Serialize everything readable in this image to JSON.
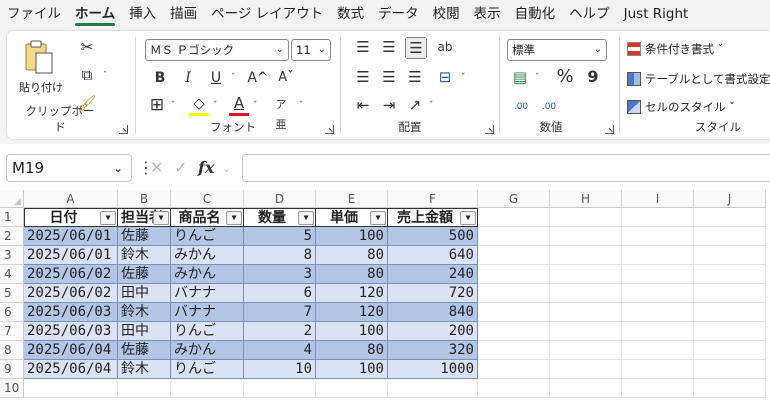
{
  "menu": {
    "tabs": [
      "ファイル",
      "ホーム",
      "挿入",
      "描画",
      "ページ レイアウト",
      "数式",
      "データ",
      "校閲",
      "表示",
      "自動化",
      "ヘルプ",
      "Just Right"
    ],
    "active": "ホーム"
  },
  "ribbon": {
    "clipboard": {
      "paste_label": "貼り付け",
      "group_label": "クリップボード"
    },
    "font": {
      "font_name": "ＭＳ Ｐゴシック",
      "font_size": "11",
      "bold": "B",
      "italic": "I",
      "underline": "U",
      "grow": "A^",
      "shrink": "Aˇ",
      "color_a": "A",
      "group_label": "フォント"
    },
    "alignment": {
      "group_label": "配置"
    },
    "number": {
      "format": "標準",
      "percent": "%",
      "comma": "9",
      "inc_decimal": ".00",
      "dec_decimal": ".00",
      "group_label": "数値"
    },
    "styles": {
      "conditional": "条件付き書式 ˇ",
      "table": "テーブルとして書式設定",
      "cell_styles": "セルのスタイル ˇ",
      "group_label": "スタイル"
    }
  },
  "formula_bar": {
    "name_box": "M19",
    "fx": "fx",
    "value": ""
  },
  "columns": [
    "A",
    "B",
    "C",
    "D",
    "E",
    "F",
    "G",
    "H",
    "I",
    "J"
  ],
  "rows": [
    "1",
    "2",
    "3",
    "4",
    "5",
    "6",
    "7",
    "8",
    "9",
    "10"
  ],
  "table": {
    "headers": [
      "日付",
      "担当者",
      "商品名",
      "数量",
      "単価",
      "売上金額"
    ],
    "rows": [
      [
        "2025/06/01",
        "佐藤",
        "りんご",
        "5",
        "100",
        "500"
      ],
      [
        "2025/06/01",
        "鈴木",
        "みかん",
        "8",
        "80",
        "640"
      ],
      [
        "2025/06/02",
        "佐藤",
        "みかん",
        "3",
        "80",
        "240"
      ],
      [
        "2025/06/02",
        "田中",
        "バナナ",
        "6",
        "120",
        "720"
      ],
      [
        "2025/06/03",
        "鈴木",
        "バナナ",
        "7",
        "120",
        "840"
      ],
      [
        "2025/06/03",
        "田中",
        "りんご",
        "2",
        "100",
        "200"
      ],
      [
        "2025/06/04",
        "佐藤",
        "みかん",
        "4",
        "80",
        "320"
      ],
      [
        "2025/06/04",
        "鈴木",
        "りんご",
        "10",
        "100",
        "1000"
      ]
    ]
  },
  "colors": {
    "band_dark": "#b4c6e7",
    "band_light": "#dae3f3",
    "accent": "#1f7a45"
  }
}
